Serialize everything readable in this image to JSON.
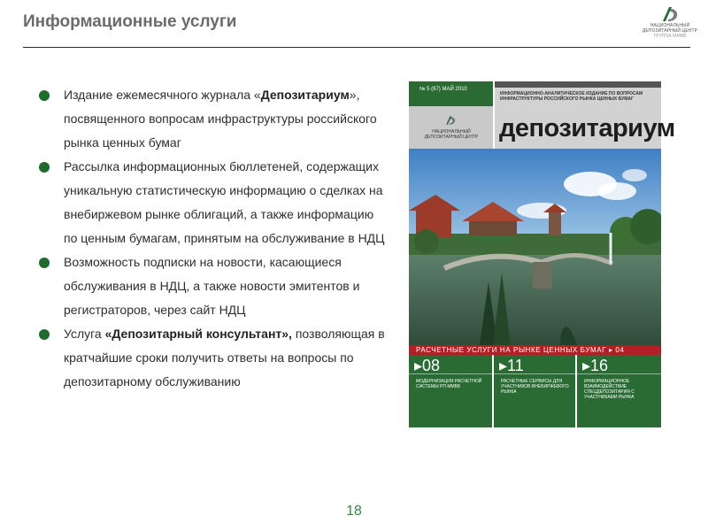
{
  "header": {
    "title": "Информационные услуги",
    "logo": {
      "line1": "НАЦИОНАЛЬНЫЙ",
      "line2": "ДЕПОЗИТАРНЫЙ ЦЕНТР",
      "line3": "ГРУППА ММВБ"
    }
  },
  "bullets": [
    {
      "pre": "Издание ежемесячного журнала «",
      "bold": "Депозитариум",
      "post": "», посвященного вопросам инфраструктуры российского рынка ценных бумаг"
    },
    {
      "pre": "Рассылка информационных бюллетеней, содержащих уникальную статистическую информацию о сделках на внебиржевом рынке облигаций, а также информацию по ценным бумагам, принятым на обслуживание в НДЦ",
      "bold": "",
      "post": ""
    },
    {
      "pre": "Возможность подписки на новости, касающиеся обслуживания в НДЦ, а также новости эмитентов и регистраторов, через сайт НДЦ",
      "bold": "",
      "post": ""
    },
    {
      "pre": "Услуга ",
      "bold": "«Депозитарный консультант»,",
      "post": " позволяющая в кратчайшие сроки получить ответы на вопросы по депозитарному обслуживанию"
    }
  ],
  "cover": {
    "issue": "№ 5 (87) МАЙ 2010",
    "mini_logo": "НАЦИОНАЛЬНЫЙ ДЕПОЗИТАРНЫЙ ЦЕНТР",
    "subtitle": "ИНФОРМАЦИОННО-АНАЛИТИЧЕСКОЕ ИЗДАНИЕ ПО ВОПРОСАМ ИНФРАСТРУКТУРЫ РОССИЙСКОГО РЫНКА ЦЕННЫХ БУМАГ",
    "name": "депозитариум",
    "band": "РАСЧЕТНЫЕ УСЛУГИ НА РЫНКЕ ЦЕННЫХ БУМАГ ▸ 04",
    "columns": [
      {
        "num": "▸08",
        "text": "МОДЕРНИЗАЦИЯ РАСЧЕТНОЙ СИСТЕМЫ РП ММВБ"
      },
      {
        "num": "▸11",
        "text": "РАСЧЕТНЫЕ СЕРВИСЫ ДЛЯ УЧАСТНИКОВ ВНЕБИРЖЕВОГО РЫНКА"
      },
      {
        "num": "▸16",
        "text": "ИНФОРМАЦИОННОЕ ВЗАИМОДЕЙСТВИЕ СПЕЦДЕПОЗИТАРИЯ С УЧАСТНИКАМИ РЫНКА"
      }
    ]
  },
  "footer": {
    "page": "18"
  },
  "colors": {
    "bullet": "#1f6b2c",
    "brand_green": "#2a6b34",
    "band_red": "#b31f24",
    "page_number": "#2d8a3a"
  }
}
